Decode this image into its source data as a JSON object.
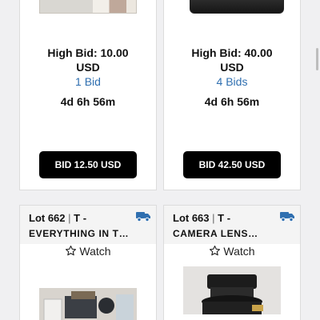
{
  "lots": [
    {
      "high_bid": "High Bid: 10.00",
      "currency": "USD",
      "bid_count": "1 Bid",
      "time_left": "4d 6h 56m",
      "bid_button": "BID 12.50 USD"
    },
    {
      "high_bid": "High Bid: 40.00",
      "currency": "USD",
      "bid_count": "4 Bids",
      "time_left": "4d 6h 56m",
      "bid_button": "BID 42.50 USD"
    },
    {
      "lot_label": "Lot 662",
      "separator": "|",
      "tag": "T -",
      "description": "EVERYTHING IN T…",
      "watch_label": "Watch"
    },
    {
      "lot_label": "Lot 663",
      "separator": "|",
      "tag": "T -",
      "description": "CAMERA LENS…",
      "watch_label": "Watch"
    }
  ],
  "colors": {
    "bid_count": "#2f6fb0",
    "shipping_icon": "#2f6fb0",
    "button_bg": "#000000"
  },
  "icons": [
    "shipping-truck-icon",
    "star-outline-icon"
  ]
}
